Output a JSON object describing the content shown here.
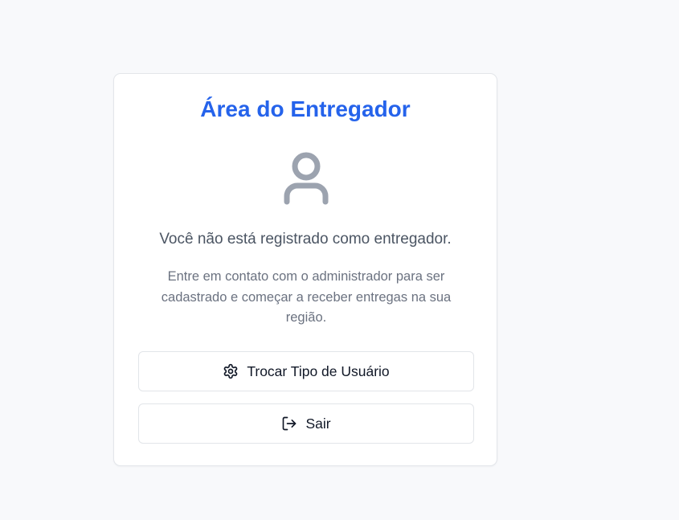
{
  "card": {
    "title": "Área do Entregador",
    "icon": "user-icon",
    "message": "Você não está registrado como entregador.",
    "description": "Entre em contato com o administrador para ser cadastrado e começar a receber entregas na sua região."
  },
  "buttons": {
    "switch_user_type": {
      "label": "Trocar Tipo de Usuário",
      "icon": "gear-icon"
    },
    "logout": {
      "label": "Sair",
      "icon": "log-out-icon"
    }
  },
  "colors": {
    "title": "#2563eb",
    "icon": "#9ca3af",
    "message": "#4b5563",
    "description": "#6b7280",
    "background": "#f8f9fb"
  }
}
